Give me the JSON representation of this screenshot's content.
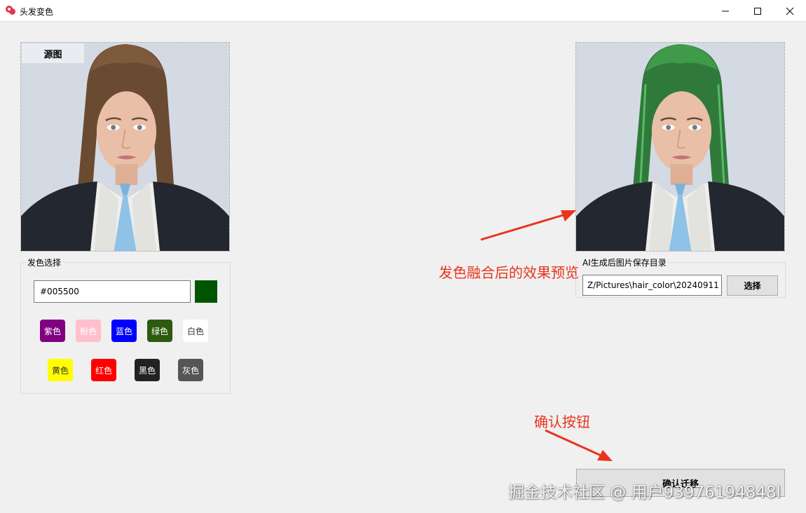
{
  "window": {
    "title": "头发变色"
  },
  "source": {
    "label": "源图"
  },
  "hair_color": {
    "group_title": "发色选择",
    "hex_value": "#005500",
    "swatch_color": "#005500",
    "presets": [
      {
        "label": "紫色",
        "bg": "#800080",
        "fg": "#ffffff"
      },
      {
        "label": "粉色",
        "bg": "#ffc0cb",
        "fg": "#ffffff"
      },
      {
        "label": "蓝色",
        "bg": "#0000ff",
        "fg": "#ffffff"
      },
      {
        "label": "绿色",
        "bg": "#2d5a0e",
        "fg": "#ffffff"
      },
      {
        "label": "白色",
        "bg": "#ffffff",
        "fg": "#333333"
      },
      {
        "label": "黄色",
        "bg": "#ffff00",
        "fg": "#333333"
      },
      {
        "label": "红色",
        "bg": "#ff0000",
        "fg": "#ffffff"
      },
      {
        "label": "黑色",
        "bg": "#222222",
        "fg": "#ffffff"
      },
      {
        "label": "灰色",
        "bg": "#555555",
        "fg": "#ffffff"
      }
    ]
  },
  "save_dir": {
    "group_title": "AI生成后图片保存目录",
    "path_value": "Z/Pictures\\hair_color\\20240911",
    "choose_label": "选择"
  },
  "confirm": {
    "label": "确认迁移"
  },
  "annotations": {
    "preview": "发色融合后的效果预览",
    "confirm": "确认按钮"
  },
  "watermark": "掘金技术社区 @ 用户93976194848l"
}
